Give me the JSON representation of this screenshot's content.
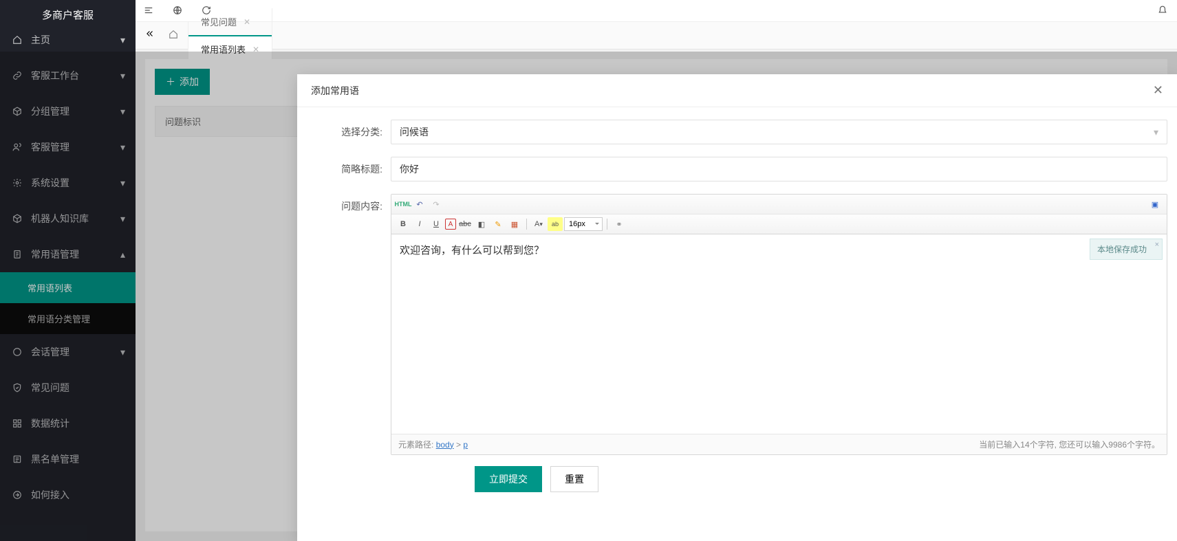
{
  "brand": "多商户客服",
  "sidebar": [
    {
      "label": "主页",
      "icon": "home",
      "expand": true
    },
    {
      "label": "客服工作台",
      "icon": "link",
      "expand": true
    },
    {
      "label": "分组管理",
      "icon": "cube",
      "expand": true
    },
    {
      "label": "客服管理",
      "icon": "users",
      "expand": true
    },
    {
      "label": "系统设置",
      "icon": "gear",
      "expand": true
    },
    {
      "label": "机器人知识库",
      "icon": "cube",
      "expand": true
    },
    {
      "label": "常用语管理",
      "icon": "doc",
      "expand": true,
      "open": true,
      "children": [
        {
          "label": "常用语列表",
          "active": true
        },
        {
          "label": "常用语分类管理"
        }
      ]
    },
    {
      "label": "会话管理",
      "icon": "chat",
      "expand": true
    },
    {
      "label": "常见问题",
      "icon": "shield",
      "expand": false
    },
    {
      "label": "数据统计",
      "icon": "grid",
      "expand": false
    },
    {
      "label": "黑名单管理",
      "icon": "list",
      "expand": false
    },
    {
      "label": "如何接入",
      "icon": "arrow",
      "expand": false
    }
  ],
  "tabs": {
    "items": [
      {
        "label": "常见问题"
      },
      {
        "label": "常用语列表",
        "active": true
      }
    ]
  },
  "page": {
    "add_btn": "添加",
    "col1": "问题标识"
  },
  "dialog": {
    "title": "添加常用语",
    "labels": {
      "category": "选择分类:",
      "title": "简略标题:",
      "content": "问题内容:"
    },
    "category_value": "问候语",
    "title_value": "你好",
    "editor_text": "欢迎咨询，有什么可以帮到您？",
    "font_size": "16px",
    "toast": "本地保存成功",
    "path_label": "元素路径:",
    "path_body": "body",
    "path_p": "p",
    "counter": "当前已输入14个字符, 您还可以输入9986个字符。",
    "submit": "立即提交",
    "reset": "重置",
    "html_btn": "HTML"
  }
}
